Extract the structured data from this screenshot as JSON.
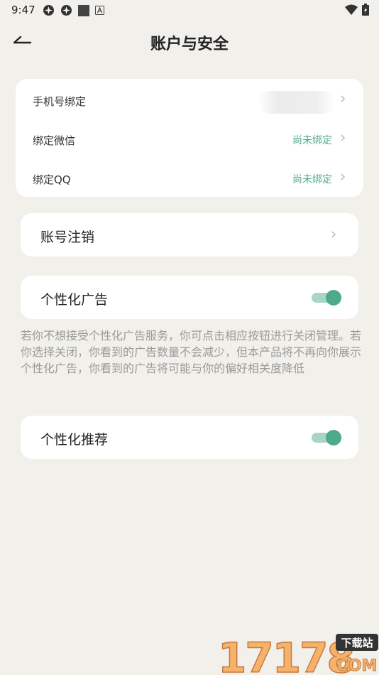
{
  "status_bar": {
    "time": "9:47",
    "icons": [
      "notification-icon",
      "notification-icon",
      "stop-icon",
      "a-icon",
      "wifi-icon",
      "battery-icon"
    ]
  },
  "header": {
    "title": "账户与安全",
    "back_icon": "back-arrow-icon"
  },
  "bindings": {
    "items": [
      {
        "label": "手机号绑定",
        "value": ""
      },
      {
        "label": "绑定微信",
        "value": "尚未绑定"
      },
      {
        "label": "绑定QQ",
        "value": "尚未绑定"
      }
    ]
  },
  "account_cancel": {
    "label": "账号注销"
  },
  "personalized_ads": {
    "label": "个性化广告",
    "enabled": true,
    "description": "若你不想接受个性化广告服务，你可点击相应按钮进行关闭管理。若你选择关闭，你看到的广告数量不会减少，但本产品将不再向你展示个性化广告，你看到的广告将可能与你的偏好相关度降低"
  },
  "personalized_recommend": {
    "label": "个性化推荐",
    "enabled": true
  },
  "watermark": {
    "number": "17178",
    "tag": "下载站",
    "domain": "COM"
  },
  "colors": {
    "background": "#f1f0eb",
    "card": "#ffffff",
    "accent": "#4faa8a",
    "accent_light": "#a8d5c4",
    "muted_text": "#9a9a9a"
  }
}
